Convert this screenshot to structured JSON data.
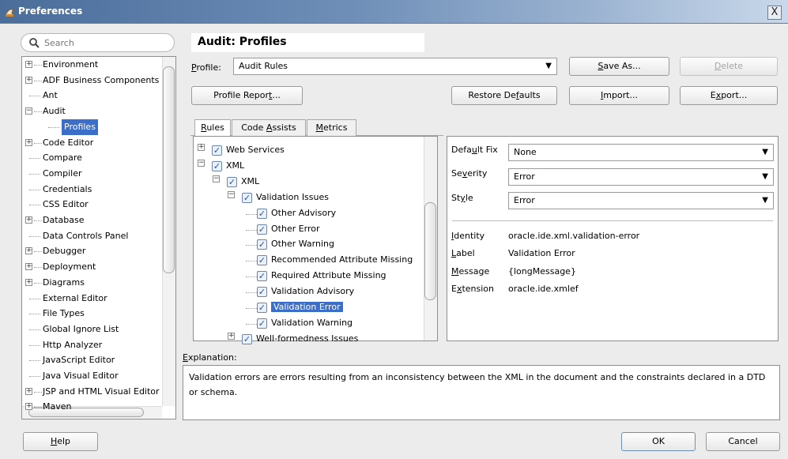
{
  "window": {
    "title": "Preferences",
    "close_glyph": "X"
  },
  "search": {
    "placeholder": "Search"
  },
  "nav": {
    "items": [
      {
        "label": "Environment",
        "expander": "+"
      },
      {
        "label": "ADF Business Components",
        "expander": "+"
      },
      {
        "label": "Ant",
        "expander": ""
      },
      {
        "label": "Audit",
        "expander": "-"
      },
      {
        "label": "Profiles",
        "expander": "",
        "selected": true,
        "child": true
      },
      {
        "label": "Code Editor",
        "expander": "+"
      },
      {
        "label": "Compare",
        "expander": ""
      },
      {
        "label": "Compiler",
        "expander": ""
      },
      {
        "label": "Credentials",
        "expander": ""
      },
      {
        "label": "CSS Editor",
        "expander": ""
      },
      {
        "label": "Database",
        "expander": "+"
      },
      {
        "label": "Data Controls Panel",
        "expander": ""
      },
      {
        "label": "Debugger",
        "expander": "+"
      },
      {
        "label": "Deployment",
        "expander": "+"
      },
      {
        "label": "Diagrams",
        "expander": "+"
      },
      {
        "label": "External Editor",
        "expander": ""
      },
      {
        "label": "File Types",
        "expander": ""
      },
      {
        "label": "Global Ignore List",
        "expander": ""
      },
      {
        "label": "Http Analyzer",
        "expander": ""
      },
      {
        "label": "JavaScript Editor",
        "expander": ""
      },
      {
        "label": "Java Visual Editor",
        "expander": ""
      },
      {
        "label": "JSP and HTML Visual Editor",
        "expander": "+"
      },
      {
        "label": "Maven",
        "expander": "+"
      }
    ]
  },
  "header": {
    "title": "Audit: Profiles"
  },
  "profile": {
    "label_u": "P",
    "label_rest": "rofile:",
    "value": "Audit Rules",
    "save_as": {
      "u": "S",
      "rest": "ave As..."
    },
    "delete": {
      "u": "D",
      "rest": "elete"
    }
  },
  "actions": {
    "profile_report": {
      "pre": "Profile Repor",
      "u": "t",
      "post": "..."
    },
    "restore_defaults": {
      "pre": "Restore De",
      "u": "f",
      "post": "aults"
    },
    "import": {
      "u": "I",
      "rest": "mport..."
    },
    "export": {
      "pre": "E",
      "u": "x",
      "post": "port..."
    }
  },
  "tabs": [
    {
      "pre": "",
      "u": "R",
      "post": "ules",
      "active": true
    },
    {
      "pre": "Code ",
      "u": "A",
      "post": "ssists",
      "active": false
    },
    {
      "pre": "",
      "u": "M",
      "post": "etrics",
      "active": false
    }
  ],
  "rules": [
    {
      "label": "Web Services",
      "level": 0,
      "expander": "+",
      "checked": true
    },
    {
      "label": "XML",
      "level": 0,
      "expander": "-",
      "checked": true
    },
    {
      "label": "XML",
      "level": 1,
      "expander": "-",
      "checked": true
    },
    {
      "label": "Validation Issues",
      "level": 2,
      "expander": "-",
      "checked": true
    },
    {
      "label": "Other Advisory",
      "level": 3,
      "expander": "",
      "checked": true
    },
    {
      "label": "Other Error",
      "level": 3,
      "expander": "",
      "checked": true
    },
    {
      "label": "Other Warning",
      "level": 3,
      "expander": "",
      "checked": true
    },
    {
      "label": "Recommended Attribute Missing",
      "level": 3,
      "expander": "",
      "checked": true
    },
    {
      "label": "Required Attribute Missing",
      "level": 3,
      "expander": "",
      "checked": true
    },
    {
      "label": "Validation Advisory",
      "level": 3,
      "expander": "",
      "checked": true
    },
    {
      "label": "Validation Error",
      "level": 3,
      "expander": "",
      "checked": true,
      "selected": true
    },
    {
      "label": "Validation Warning",
      "level": 3,
      "expander": "",
      "checked": true
    },
    {
      "label": "Well-formedness Issues",
      "level": 2,
      "expander": "+",
      "checked": true
    }
  ],
  "details": {
    "default_fix": {
      "pre": "Defa",
      "u": "u",
      "post": "lt Fix",
      "value": "None"
    },
    "severity": {
      "pre": "Se",
      "u": "v",
      "post": "erity",
      "value": "Error"
    },
    "style": {
      "pre": "St",
      "u": "y",
      "post": "le",
      "value": "Error"
    },
    "identity": {
      "pre": "",
      "u": "I",
      "post": "dentity",
      "value": "oracle.ide.xml.validation-error"
    },
    "label": {
      "pre": "",
      "u": "L",
      "post": "abel",
      "value": "Validation Error"
    },
    "message": {
      "pre": "",
      "u": "M",
      "post": "essage",
      "value": "{longMessage}"
    },
    "extension": {
      "pre": "E",
      "u": "x",
      "post": "tension",
      "value": "oracle.ide.xmlef"
    }
  },
  "explanation": {
    "pre": "",
    "u": "E",
    "post": "xplanation:",
    "text": "Validation errors are errors resulting from an inconsistency between the XML in the document and the constraints declared in a DTD or schema."
  },
  "footer": {
    "help": {
      "u": "H",
      "rest": "elp"
    },
    "ok": "OK",
    "cancel": "Cancel"
  },
  "colors": {
    "selection": "#3b6ec8",
    "title_bar": "#4a6d9a",
    "check": "#2a55a4"
  },
  "icons": [
    "preferences-app-icon",
    "close-icon",
    "search-icon",
    "expand-icon",
    "collapse-icon",
    "checkbox-checked-icon",
    "dropdown-arrow-icon"
  ]
}
